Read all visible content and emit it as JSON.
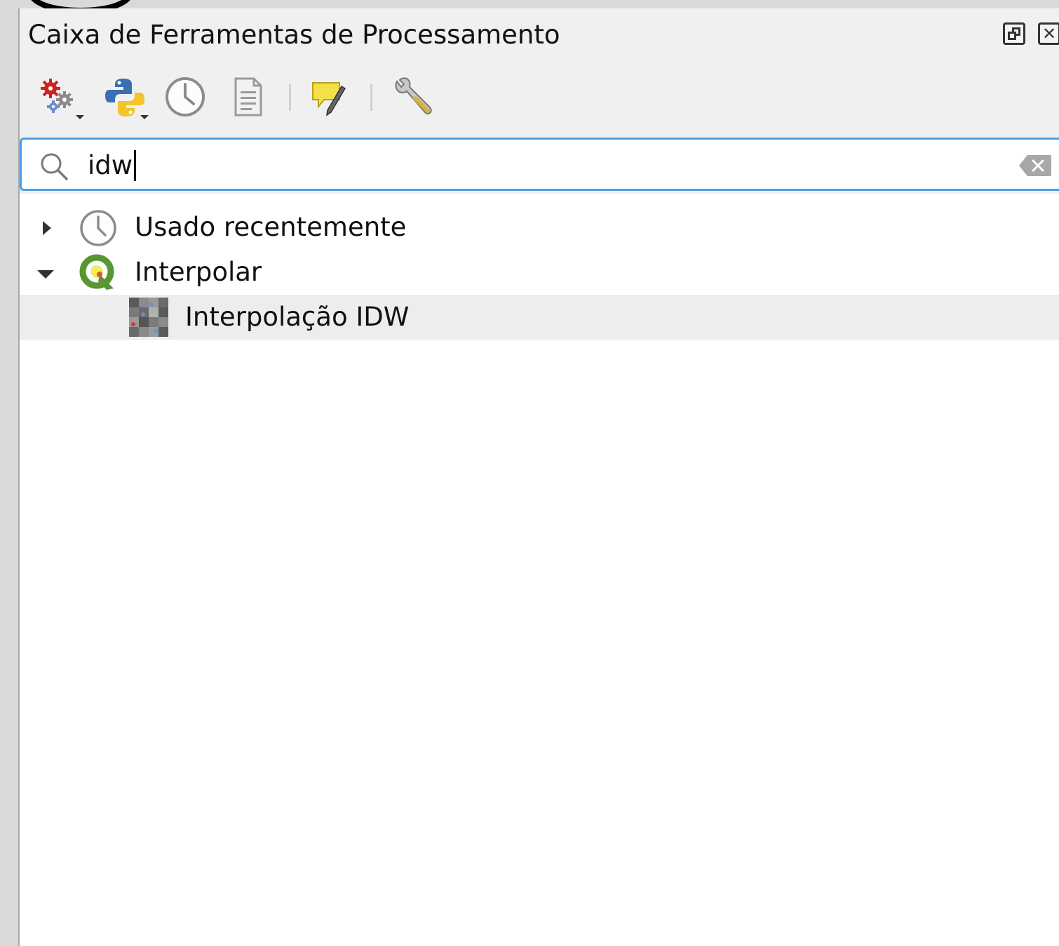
{
  "panel": {
    "title": "Caixa de Ferramentas de Processamento",
    "window_buttons": [
      {
        "name": "float-icon"
      },
      {
        "name": "close-icon"
      }
    ]
  },
  "toolbar": {
    "buttons": [
      {
        "name": "models-gear-icon",
        "has_dropdown": true
      },
      {
        "name": "python-icon",
        "has_dropdown": true
      },
      {
        "name": "history-clock-icon",
        "has_dropdown": false
      },
      {
        "name": "results-document-icon",
        "has_dropdown": false
      },
      {
        "name": "edit-features-in-place-icon",
        "has_dropdown": false
      },
      {
        "name": "options-wrench-icon",
        "has_dropdown": false
      }
    ]
  },
  "search": {
    "value": "idw",
    "placeholder": ""
  },
  "tree": {
    "items": [
      {
        "label": "Usado recentemente",
        "icon": "clock-icon",
        "expanded": false,
        "level": 0
      },
      {
        "label": "Interpolar",
        "icon": "qgis-logo-icon",
        "expanded": true,
        "level": 0
      },
      {
        "label": "Interpolação IDW",
        "icon": "raster-interpolation-icon",
        "level": 1,
        "selected": true
      }
    ]
  },
  "colors": {
    "accent": "#4a9fe5",
    "panel_bg": "#f0f0f0",
    "selected_row": "#ededed",
    "qgis_green": "#589632",
    "qgis_yellow": "#eeee5e"
  }
}
